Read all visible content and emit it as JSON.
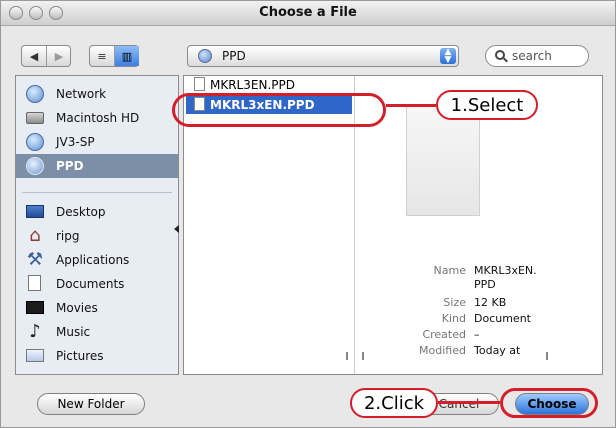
{
  "window": {
    "title": "Choose a File"
  },
  "toolbar": {
    "back_icon": "back-arrow-icon",
    "forward_icon": "forward-arrow-icon",
    "view_list_icon": "list-view-icon",
    "view_column_icon": "column-view-icon",
    "location": "PPD",
    "search_placeholder": "search"
  },
  "sidebar": {
    "devices": [
      {
        "label": "Network",
        "icon": "globe-icon"
      },
      {
        "label": "Macintosh HD",
        "icon": "harddisk-icon"
      },
      {
        "label": "JV3-SP",
        "icon": "globe-icon"
      },
      {
        "label": "PPD",
        "icon": "globe-icon",
        "selected": true
      }
    ],
    "places": [
      {
        "label": "Desktop",
        "icon": "desktop-icon"
      },
      {
        "label": "ripg",
        "icon": "home-icon"
      },
      {
        "label": "Applications",
        "icon": "applications-icon"
      },
      {
        "label": "Documents",
        "icon": "documents-icon"
      },
      {
        "label": "Movies",
        "icon": "movies-icon"
      },
      {
        "label": "Music",
        "icon": "music-icon"
      },
      {
        "label": "Pictures",
        "icon": "pictures-icon"
      }
    ]
  },
  "browser": {
    "files": [
      {
        "label": "MKRL3EN.PPD"
      },
      {
        "label": "MKRL3xEN.PPD",
        "selected": true
      }
    ],
    "preview": {
      "name_label": "Name",
      "name_value_1": "MKRL3xEN.",
      "name_value_2": "PPD",
      "size_label": "Size",
      "size_value": "12 KB",
      "kind_label": "Kind",
      "kind_value": "Document",
      "created_label": "Created",
      "created_value": "–",
      "modified_label": "Modified",
      "modified_value": "Today at"
    }
  },
  "footer": {
    "new_folder": "New Folder",
    "cancel": "Cancel",
    "choose": "Choose"
  },
  "annotations": {
    "select": "1.Select",
    "click": "2.Click",
    "accent_color": "#d41f2b"
  }
}
